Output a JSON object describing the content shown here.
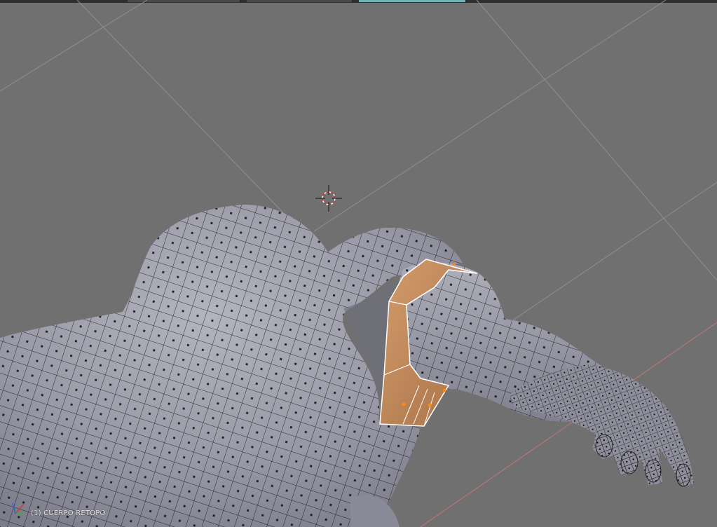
{
  "app": "Blender",
  "viewport": {
    "mode": "Edit Mode",
    "shading": "solid-wireframe",
    "object_label": "(1) CUERPO RETOPO",
    "active_tab_color": "#6fb3b3"
  },
  "icons": {
    "cursor": "3d-cursor-icon",
    "axis": "axis-gizmo-icon"
  },
  "colors": {
    "background": "#707070",
    "grid_line": "#8a8a8a",
    "x_axis": "#c07070",
    "mesh_face": "#9595a3",
    "mesh_wire": "#111111",
    "selection_face": "#c58a5a",
    "selection_edge": "#ffffff",
    "selected_vertex": "#ff8a10"
  }
}
